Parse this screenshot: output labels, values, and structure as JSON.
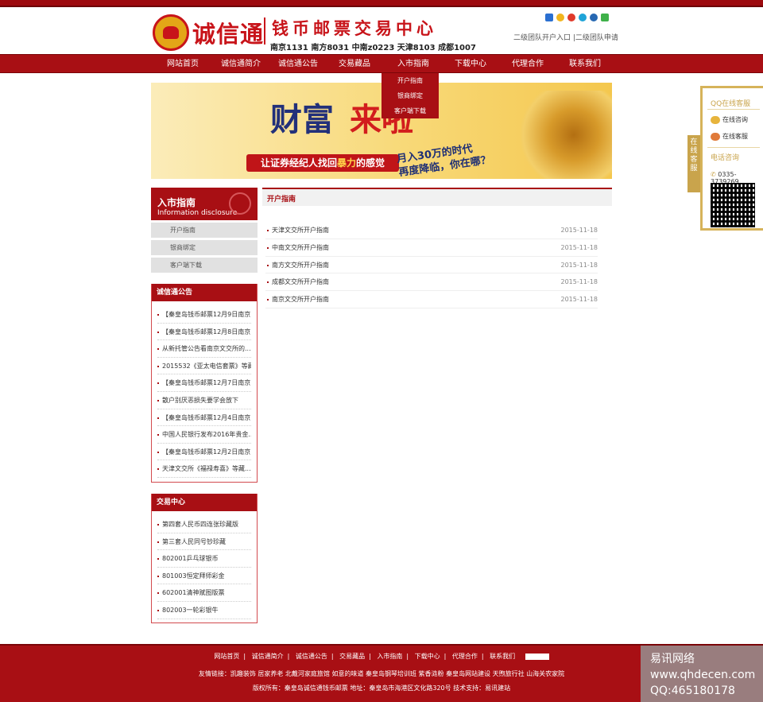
{
  "brand": {
    "name": "诚信通",
    "title": "钱币邮票交易中心",
    "exchanges": "南京1131  南方8031  中南z0223  天津8103  成都1007"
  },
  "header_links": "二级团队开户入口 |二级团队申请",
  "nav": {
    "items": [
      "网站首页",
      "诚信通简介",
      "诚信通公告",
      "交易藏品",
      "入市指南",
      "下载中心",
      "代理合作",
      "联系我们"
    ],
    "dropdown": [
      "开户指南",
      "银商绑定",
      "客户端下载"
    ]
  },
  "banner": {
    "big1": "财富",
    "big2": "来啦",
    "ribbon_prefix": "让证券经纪人找回",
    "ribbon_hl": "暴力",
    "ribbon_suffix": "的感觉",
    "slogan1": "月入30万的时代",
    "slogan2": "再度降临，你在哪？"
  },
  "sidebar": {
    "title": "入市指南",
    "subtitle": "Information disclosure",
    "items": [
      "开户指南",
      "银商绑定",
      "客户端下载"
    ]
  },
  "notices": {
    "title": "诚信通公告",
    "items": [
      "【秦皇岛钱币邮票12月9日南京...",
      "【秦皇岛钱币邮票12月8日南京...",
      "从新托管公告看南京文交所的...",
      "2015532《亚太电信套票》等藏...",
      "【秦皇岛钱币邮票12月7日南京...",
      "散户别厌恶损失要学会放下",
      "【秦皇岛钱币邮票12月4日南京...",
      "中国人民银行发布2016年贵金...",
      "【秦皇岛钱币邮票12月2日南京...",
      "天津文交所《福禄寿喜》等藏..."
    ]
  },
  "trading": {
    "title": "交易中心",
    "items": [
      "第四套人民币四连张珍藏版",
      "第三套人民同号钞珍藏",
      "802001乒乓球银币",
      "801003恒定拜师彩金",
      "602001清神赋图版票",
      "802003一轮彩银牛"
    ]
  },
  "main": {
    "title": "开户指南",
    "rows": [
      {
        "title": "天津文交所开户指南",
        "date": "2015-11-18"
      },
      {
        "title": "中南文交所开户指南",
        "date": "2015-11-18"
      },
      {
        "title": "南方文交所开户指南",
        "date": "2015-11-18"
      },
      {
        "title": "成都文交所开户指南",
        "date": "2015-11-18"
      },
      {
        "title": "南京文交所开户指南",
        "date": "2015-11-18"
      }
    ]
  },
  "float_service": {
    "tab": "在线客服",
    "qq_title": "QQ在线客服",
    "btn1": "在线咨询",
    "btn2": "在线客服",
    "phone_title": "电话咨询",
    "phone": "0335-3739269"
  },
  "footer": {
    "nav": [
      "网站首页",
      "诚信通简介",
      "诚信通公告",
      "交易藏品",
      "入市指南",
      "下载中心",
      "代理合作",
      "联系我们"
    ],
    "links": "友情链接：凯趣装饰   居家养老   北戴河家庭旅馆   如意的味道   秦皇岛钢琴培训班   紫香涟粉   秦皇岛网站建设   天煦旅行社   山海关农家院",
    "copyright": "版权所有：秦皇岛诚信通钱币邮票          地址：秦皇岛市海港区文化路320号 技术支持：易讯建站"
  },
  "watermark": {
    "line1": "易讯网络",
    "line2": "www.qhdecen.com",
    "line3": "QQ:465180178"
  },
  "colors": {
    "primary": "#a80f14",
    "gold": "#c9a44c"
  }
}
